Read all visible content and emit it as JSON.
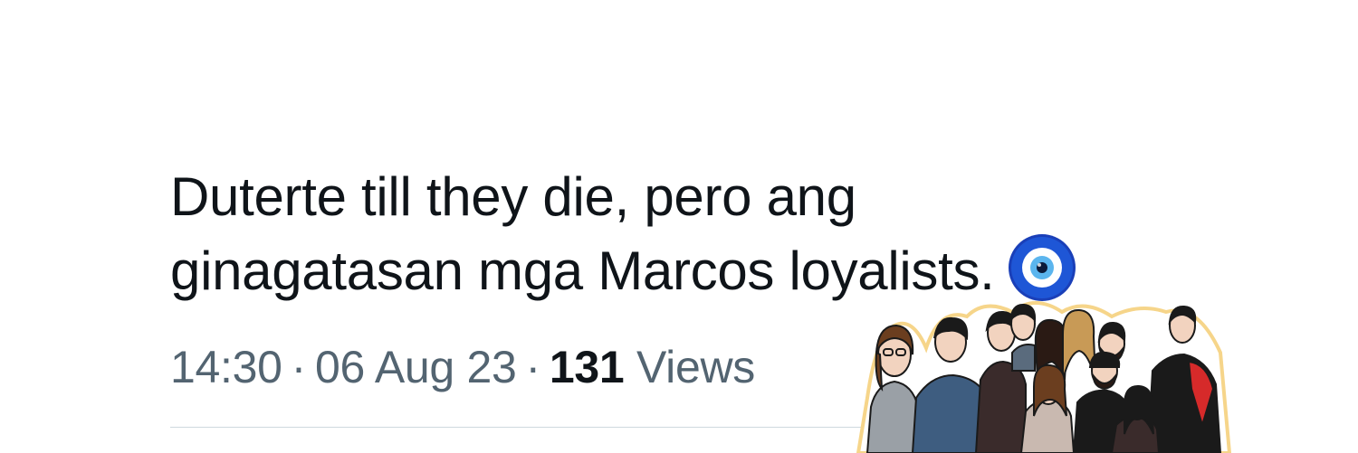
{
  "tweet": {
    "text_line_1": "Duterte till they die, pero ang",
    "text_line_2": "ginagatasan mga Marcos loyalists.",
    "emoji_icon": "nazar-amulet-icon"
  },
  "meta": {
    "time": "14:30",
    "separator": "·",
    "date": "06 Aug 23",
    "views_count": "131",
    "views_label": "Views"
  },
  "sticker": {
    "icon": "group-of-people-sticker"
  },
  "colors": {
    "text_primary": "#0f1419",
    "text_secondary": "#536471",
    "divider": "#cfd9de",
    "nazar_blue": "#1a4fd0"
  }
}
